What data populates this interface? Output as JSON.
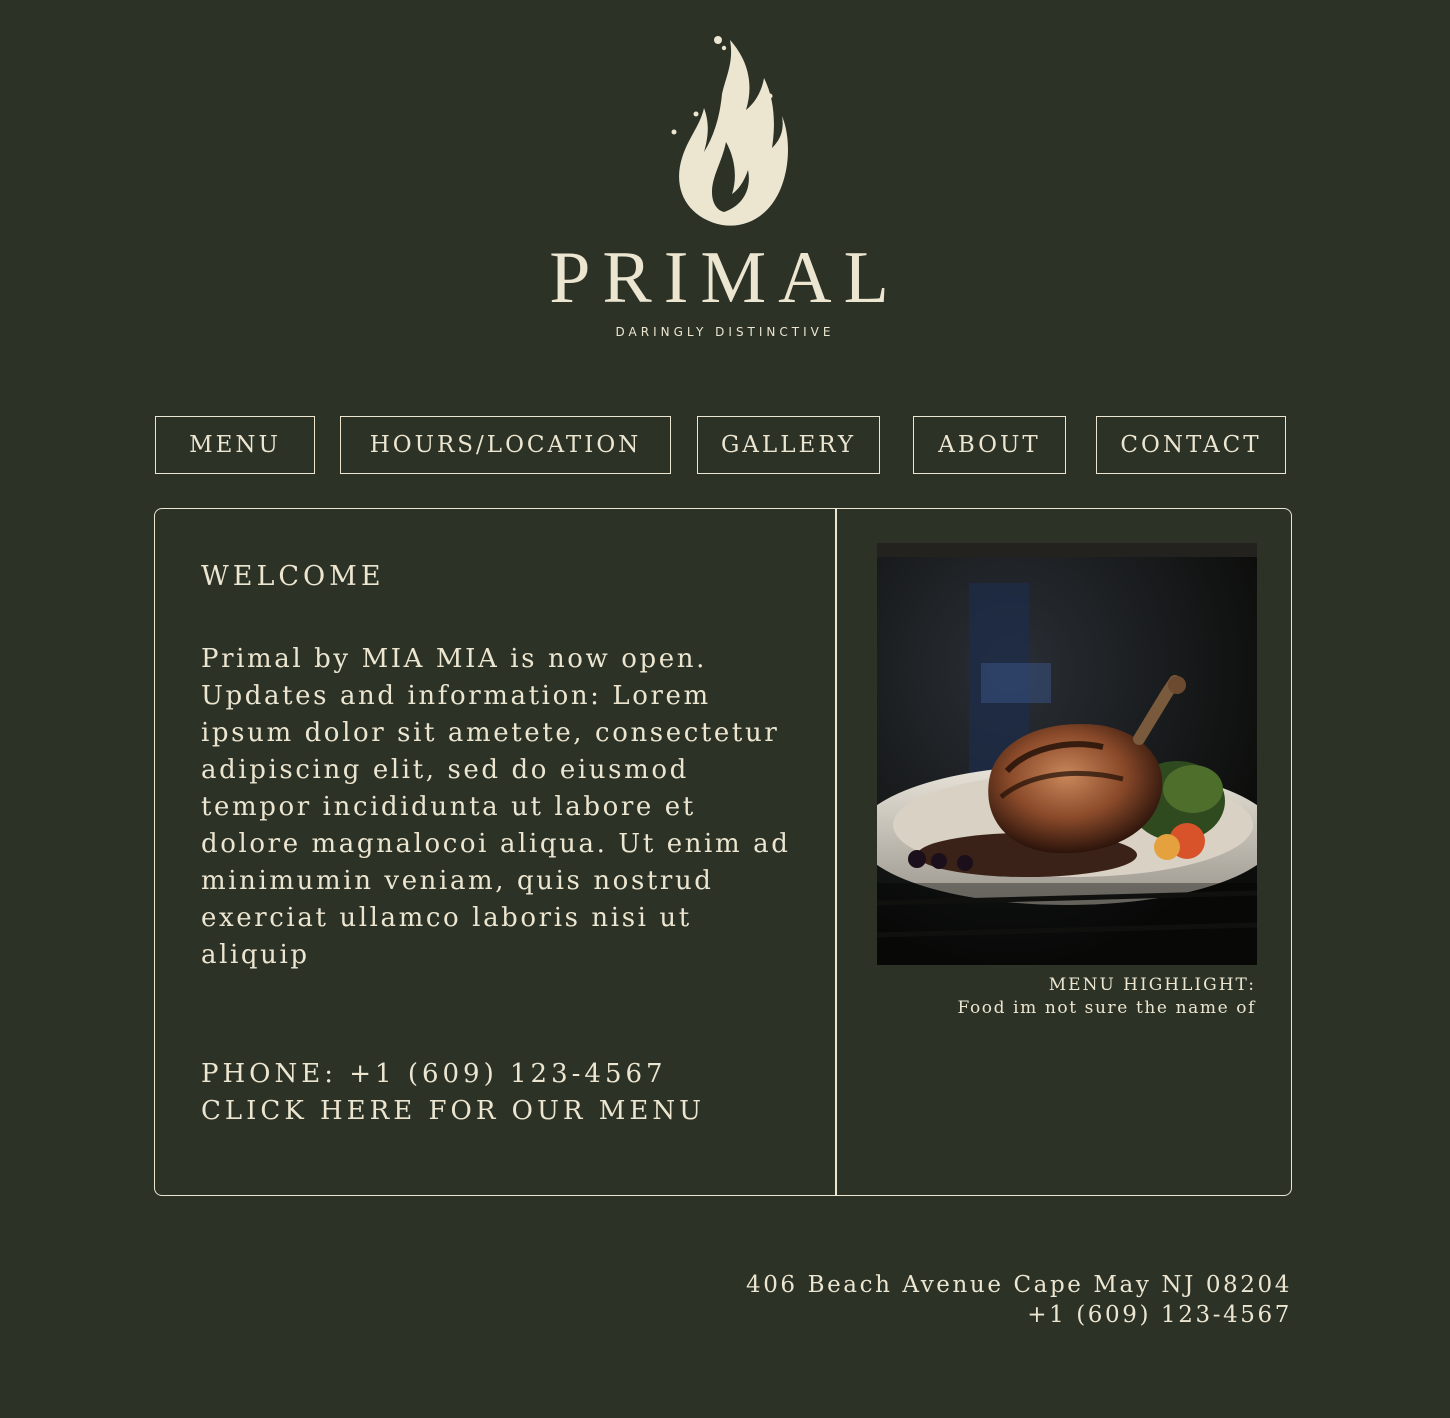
{
  "brand": {
    "name": "PRIMAL",
    "tagline": "DARINGLY DISTINCTIVE",
    "logo_icon": "flame-icon"
  },
  "nav": {
    "items": [
      {
        "label": "MENU"
      },
      {
        "label": "HOURS/LOCATION"
      },
      {
        "label": "GALLERY"
      },
      {
        "label": "ABOUT"
      },
      {
        "label": "CONTACT"
      }
    ]
  },
  "welcome": {
    "title": "WELCOME",
    "body": "Primal by MIA MIA is now open. Updates and information: Lorem ipsum dolor sit ametete, consectetur adipiscing elit, sed do eiusmod tempor incididunta ut labore et dolore magnalocoi aliqua. Ut enim ad minimumin veniam, quis nostrud exerciat ullamco laboris nisi ut aliquip",
    "phone": "PHONE: +1 (609) 123-4567",
    "menu_link": "CLICK HERE FOR OUR MENU"
  },
  "highlight": {
    "title": "MENU HIGHLIGHT:",
    "caption": "Food im not sure the name of"
  },
  "footer": {
    "address": "406 Beach Avenue Cape May NJ 08204",
    "phone": "+1 (609) 123-4567"
  },
  "colors": {
    "background": "#2c3226",
    "foreground": "#ece6d1"
  }
}
